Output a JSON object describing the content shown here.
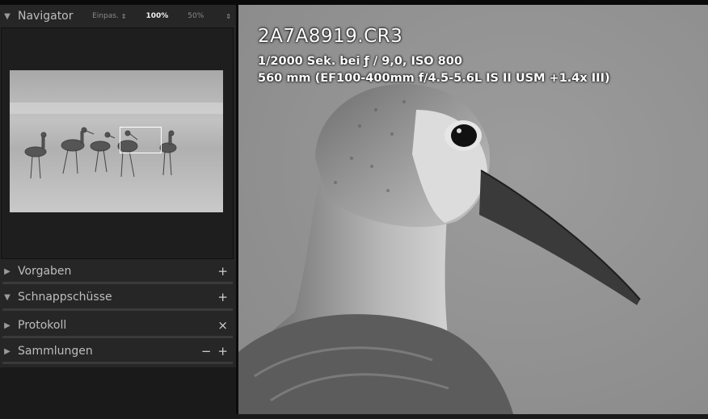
{
  "navigator": {
    "title": "Navigator",
    "zoom_options": [
      {
        "label": "Einpas.",
        "active": false
      },
      {
        "label": "100%",
        "active": true
      },
      {
        "label": "50%",
        "active": false
      }
    ]
  },
  "panels": [
    {
      "label": "Vorgaben",
      "expanded": false,
      "actions": [
        "+"
      ]
    },
    {
      "label": "Schnappschüsse",
      "expanded": true,
      "actions": [
        "+"
      ]
    },
    {
      "label": "Protokoll",
      "expanded": false,
      "actions": [
        "×"
      ]
    },
    {
      "label": "Sammlungen",
      "expanded": false,
      "actions": [
        "−",
        "+"
      ]
    }
  ],
  "photo": {
    "filename": "2A7A8919.CR3",
    "exposure": "1/2000 Sek. bei ƒ / 9,0, ISO 800",
    "lens": "560 mm (EF100-400mm f/4.5-5.6L IS II USM +1.4x III)"
  },
  "icons": {
    "expanded": "triangle-down-icon",
    "collapsed": "triangle-right-icon",
    "updown": "updown-arrows-icon"
  }
}
